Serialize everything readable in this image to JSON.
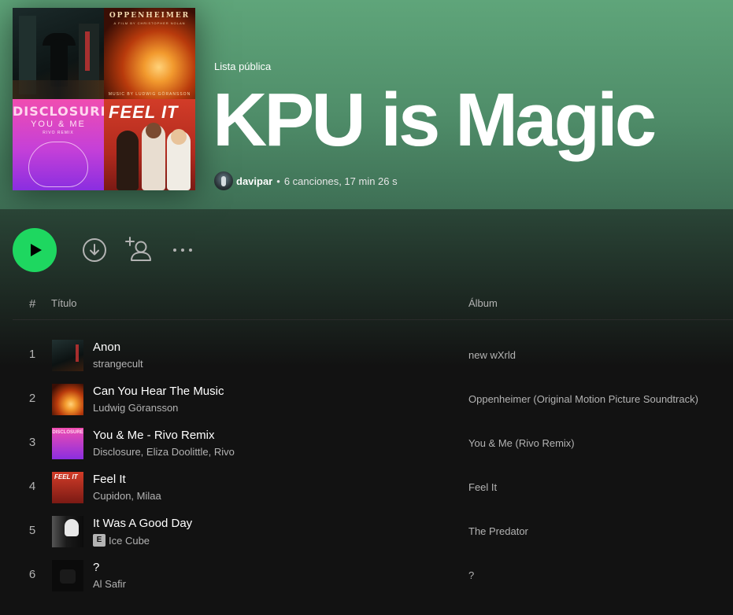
{
  "colors": {
    "accent": "#1ed760",
    "header_bg": "#4f8d69",
    "page_bg": "#121212"
  },
  "playlist": {
    "type_label": "Lista pública",
    "title": "KPU is Magic",
    "owner": "davipar",
    "separator": "•",
    "stats": "6 canciones, 17 min 26 s"
  },
  "cover_art": {
    "opp_title": "OPPENHEIMER",
    "opp_sub": "A FILM BY CHRISTOPHER NOLAN",
    "opp_credit": "MUSIC BY LUDWIG GÖRANSSON",
    "disc_title": "DISCLOSURE",
    "disc_sub": "YOU & ME",
    "disc_remix": "RIVO REMIX",
    "feel_title": "FEEL IT"
  },
  "actions": {
    "play_icon": "play-icon",
    "download_icon": "download-circle-icon",
    "follow_icon": "add-user-icon",
    "more_icon": "more-horizontal-icon"
  },
  "columns": {
    "num": "#",
    "title": "Título",
    "album": "Álbum"
  },
  "tracks": [
    {
      "num": "1",
      "name": "Anon",
      "artist": "strangecult",
      "explicit": false,
      "album": "new wXrld"
    },
    {
      "num": "2",
      "name": "Can You Hear The Music",
      "artist": "Ludwig Göransson",
      "explicit": false,
      "album": "Oppenheimer (Original Motion Picture Soundtrack)"
    },
    {
      "num": "3",
      "name": "You & Me - Rivo Remix",
      "artist": "Disclosure, Eliza Doolittle, Rivo",
      "explicit": false,
      "album": "You & Me (Rivo Remix)"
    },
    {
      "num": "4",
      "name": "Feel It",
      "artist": "Cupidon, Milaa",
      "explicit": false,
      "album": "Feel It"
    },
    {
      "num": "5",
      "name": "It Was A Good Day",
      "artist": "Ice Cube",
      "explicit": true,
      "explicit_label": "E",
      "album": "The Predator"
    },
    {
      "num": "6",
      "name": "?",
      "artist": "Al Safir",
      "explicit": false,
      "album": "?"
    }
  ]
}
